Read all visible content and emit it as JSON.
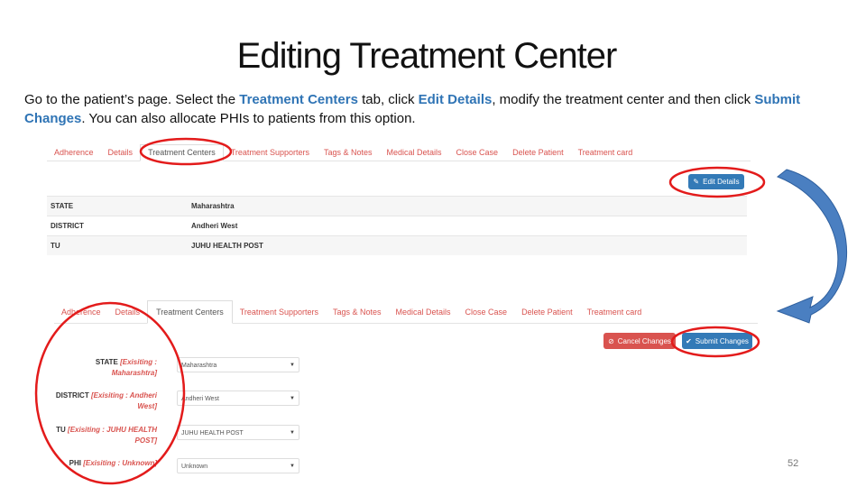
{
  "slide": {
    "title": "Editing Treatment Center",
    "page_number": "52"
  },
  "instructions": {
    "t1": "Go to the patient’s page. Select the ",
    "h1": "Treatment Centers",
    "t2": " tab, click ",
    "h2": "Edit Details",
    "t3": ", modify the treatment center and then click ",
    "h3": "Submit Changes",
    "t4": ". You can also allocate PHIs to patients from this option."
  },
  "tabs": [
    "Adherence",
    "Details",
    "Treatment Centers",
    "Treatment Supporters",
    "Tags & Notes",
    "Medical Details",
    "Close Case",
    "Delete Patient",
    "Treatment card"
  ],
  "active_tab": "Treatment Centers",
  "edit_button": {
    "label": "Edit Details",
    "icon": "pencil-icon"
  },
  "details_table": [
    {
      "label": "STATE",
      "value": "Maharashtra"
    },
    {
      "label": "DISTRICT",
      "value": "Andheri West"
    },
    {
      "label": "TU",
      "value": "JUHU HEALTH POST"
    }
  ],
  "cancel_button": {
    "label": "Cancel Changes",
    "icon": "ban-icon"
  },
  "submit_button": {
    "label": "Submit Changes",
    "icon": "check-icon"
  },
  "form": {
    "state": {
      "label": "STATE",
      "existing": "[Exisiting : Maharashtra]",
      "value": "Maharashtra"
    },
    "district": {
      "label": "DISTRICT",
      "existing": "[Exisiting : Andheri West]",
      "value": "Andheri West"
    },
    "tu": {
      "label": "TU",
      "existing": "[Exisiting : JUHU HEALTH POST]",
      "value": "JUHU HEALTH POST"
    },
    "phi": {
      "label": "PHI",
      "existing": "[Exisiting : Unknown]",
      "value": "Unknown"
    }
  },
  "colors": {
    "highlight_text": "#2f74b5",
    "annotation_red": "#e31b1b",
    "tab_link": "#d9534f",
    "primary_button": "#337ab7",
    "danger_button": "#d9534f",
    "arrow_blue": "#4a7fc1"
  }
}
